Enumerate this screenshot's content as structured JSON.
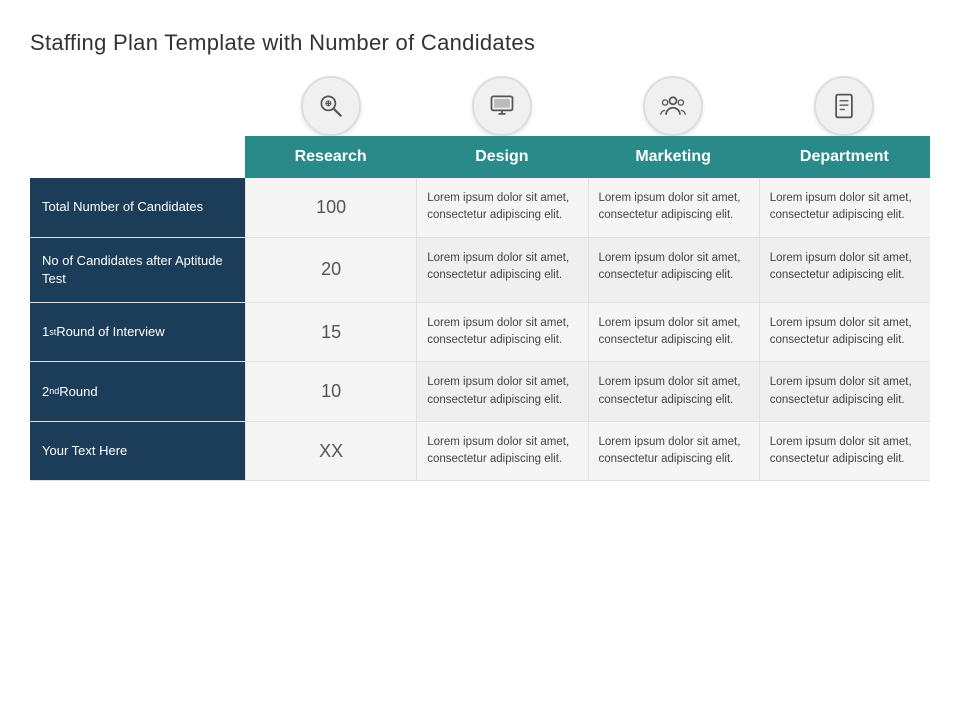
{
  "title": "Staffing Plan Template with Number of Candidates",
  "icons": [
    {
      "name": "search-analytics-icon",
      "symbol": "🔍",
      "unicode": "&#128269;"
    },
    {
      "name": "monitor-icon",
      "symbol": "🖥",
      "unicode": "&#128421;"
    },
    {
      "name": "marketing-icon",
      "symbol": "👥",
      "unicode": "&#128101;"
    },
    {
      "name": "document-icon",
      "symbol": "📄",
      "unicode": "&#128196;"
    }
  ],
  "columns": [
    {
      "label": "Research"
    },
    {
      "label": "Design"
    },
    {
      "label": "Marketing"
    },
    {
      "label": "Department"
    }
  ],
  "rows": [
    {
      "label": "Total Number of Candidates",
      "superscript": "",
      "label_suffix": "",
      "number": "100",
      "cells": [
        "Lorem ipsum dolor sit amet, consectetur adipiscing elit.",
        "Lorem ipsum dolor sit amet, consectetur adipiscing elit.",
        "Lorem ipsum dolor sit amet, consectetur adipiscing elit."
      ]
    },
    {
      "label": "No of Candidates after Aptitude Test",
      "superscript": "",
      "label_suffix": "",
      "number": "20",
      "cells": [
        "Lorem ipsum dolor sit amet, consectetur adipiscing elit.",
        "Lorem ipsum dolor sit amet, consectetur adipiscing elit.",
        "Lorem ipsum dolor sit amet, consectetur adipiscing elit."
      ]
    },
    {
      "label": "1st Round of Interview",
      "superscript": "st",
      "label_base": "1",
      "label_rest": " Round of Interview",
      "number": "15",
      "cells": [
        "Lorem ipsum dolor sit amet, consectetur adipiscing elit.",
        "Lorem ipsum dolor sit amet, consectetur adipiscing elit.",
        "Lorem ipsum dolor sit amet, consectetur adipiscing elit."
      ]
    },
    {
      "label": "2nd Round",
      "superscript": "nd",
      "label_base": "2",
      "label_rest": " Round",
      "number": "10",
      "cells": [
        "Lorem ipsum dolor sit amet, consectetur adipiscing elit.",
        "Lorem ipsum dolor sit amet, consectetur adipiscing elit.",
        "Lorem ipsum dolor sit amet, consectetur adipiscing elit."
      ]
    },
    {
      "label": "Your Text Here",
      "superscript": "",
      "label_suffix": "",
      "number": "XX",
      "cells": [
        "Lorem ipsum dolor sit amet, consectetur adipiscing elit.",
        "Lorem ipsum dolor sit amet, consectetur adipiscing elit.",
        "Lorem ipsum dolor sit amet, consectetur adipiscing elit."
      ]
    }
  ],
  "lorem": "Lorem ipsum dolor sit amet, consectetur adipiscing elit."
}
